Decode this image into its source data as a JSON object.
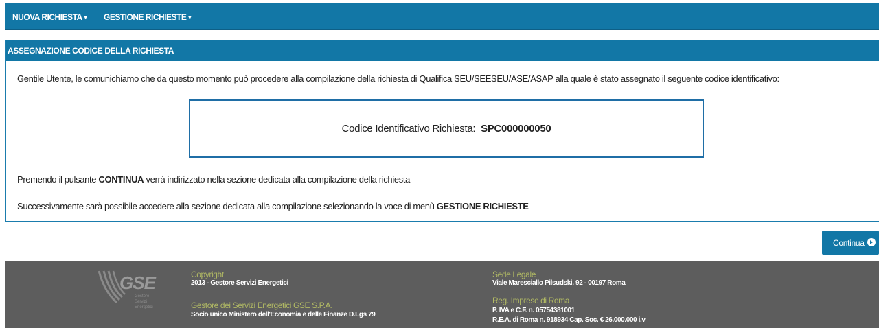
{
  "nav": {
    "items": [
      {
        "label": "NUOVA RICHIESTA"
      },
      {
        "label": "GESTIONE RICHIESTE"
      }
    ],
    "caret": "▾"
  },
  "panel": {
    "title": "ASSEGNAZIONE CODICE DELLA RICHIESTA",
    "intro": "Gentile Utente, le comunichiamo che da questo momento può procedere alla compilazione della richiesta di Qualifica SEU/SEESEU/ASE/ASAP alla quale è stato assegnato il seguente codice identificativo:",
    "code_label": "Codice Identificativo Richiesta: ",
    "code_value": "SPC000000050",
    "info1_pre": "Premendo il pulsante ",
    "info1_bold": "CONTINUA",
    "info1_post": " verrà indirizzato nella sezione dedicata alla compilazione della richiesta",
    "info2_pre": "Successivamente sarà possibile accedere alla sezione dedicata alla compilazione selezionando la voce di menù ",
    "info2_bold": "GESTIONE RICHIESTE"
  },
  "continue_button": {
    "label": "Continua",
    "icon": "arrow-right-circle-icon"
  },
  "footer": {
    "logo_text": "GSE",
    "logo_subtext": [
      "Gestore",
      "Servizi",
      "Energetici"
    ],
    "copyright_label": "Copyright",
    "copyright_value": "2013 - Gestore Servizi Energetici",
    "company_label": "Gestore dei Servizi Energetici GSE S.P.A.",
    "company_value": "Socio unico Ministero dell'Economia e delle Finanze D.Lgs 79",
    "sede_label": "Sede Legale",
    "sede_value": "Viale Maresciallo Pilsudski, 92 - 00197 Roma",
    "reg_label": "Reg. Imprese di Roma",
    "reg_value1": "P. IVA e C.F. n. 05754381001",
    "reg_value2": "R.E.A. di Roma n. 918934 Cap. Soc. € 26.000.000 i.v"
  },
  "colors": {
    "primary": "#1277a6",
    "footer": "#5d5d5d",
    "footer_label": "#b1b964"
  }
}
